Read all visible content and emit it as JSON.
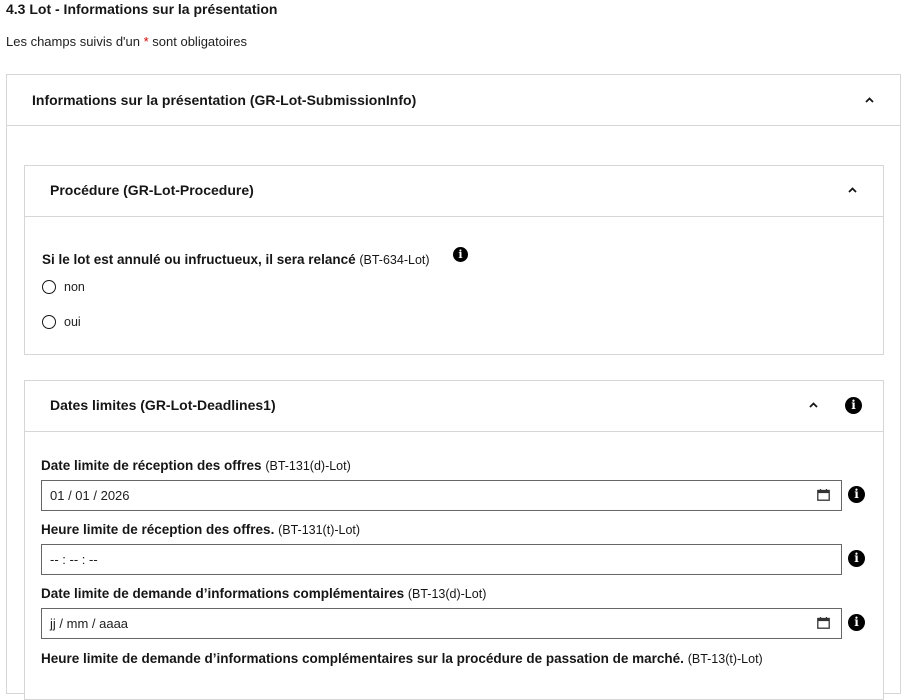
{
  "page": {
    "title": "4.3 Lot - Informations sur la présentation",
    "required_note_prefix": "Les champs suivis d'un ",
    "required_star": "*",
    "required_note_suffix": " sont obligatoires"
  },
  "submission_panel": {
    "title": "Informations sur la présentation (GR-Lot-SubmissionInfo)",
    "icon": "chevron-up-icon"
  },
  "procedure_panel": {
    "title": "Procédure (GR-Lot-Procedure)",
    "question": {
      "label": "Si le lot est annulé ou infructueux, il sera relancé",
      "code": "(BT-634-Lot)"
    },
    "options": [
      "non",
      "oui"
    ]
  },
  "deadlines_panel": {
    "title": "Dates limites (GR-Lot-Deadlines1)",
    "fields": [
      {
        "label": "Date limite de réception des offres",
        "code": "(BT-131(d)-Lot)",
        "value": "01 / 01 / 2026",
        "type": "date"
      },
      {
        "label": "Heure limite de réception des offres.",
        "code": "(BT-131(t)-Lot)",
        "value": "-- : -- : --",
        "type": "time"
      },
      {
        "label": "Date limite de demande d’informations complémentaires",
        "code": "(BT-13(d)-Lot)",
        "value": "jj / mm / aaaa",
        "type": "date"
      },
      {
        "label": "Heure limite de demande d’informations complémentaires sur la procédure de passation de marché.",
        "code": "(BT-13(t)-Lot)"
      }
    ]
  },
  "icons": {
    "info": "info-icon",
    "calendar": "calendar-icon"
  },
  "colors": {
    "required_star": "#ce0500",
    "border": "#d6d6d6",
    "text": "#161616"
  }
}
